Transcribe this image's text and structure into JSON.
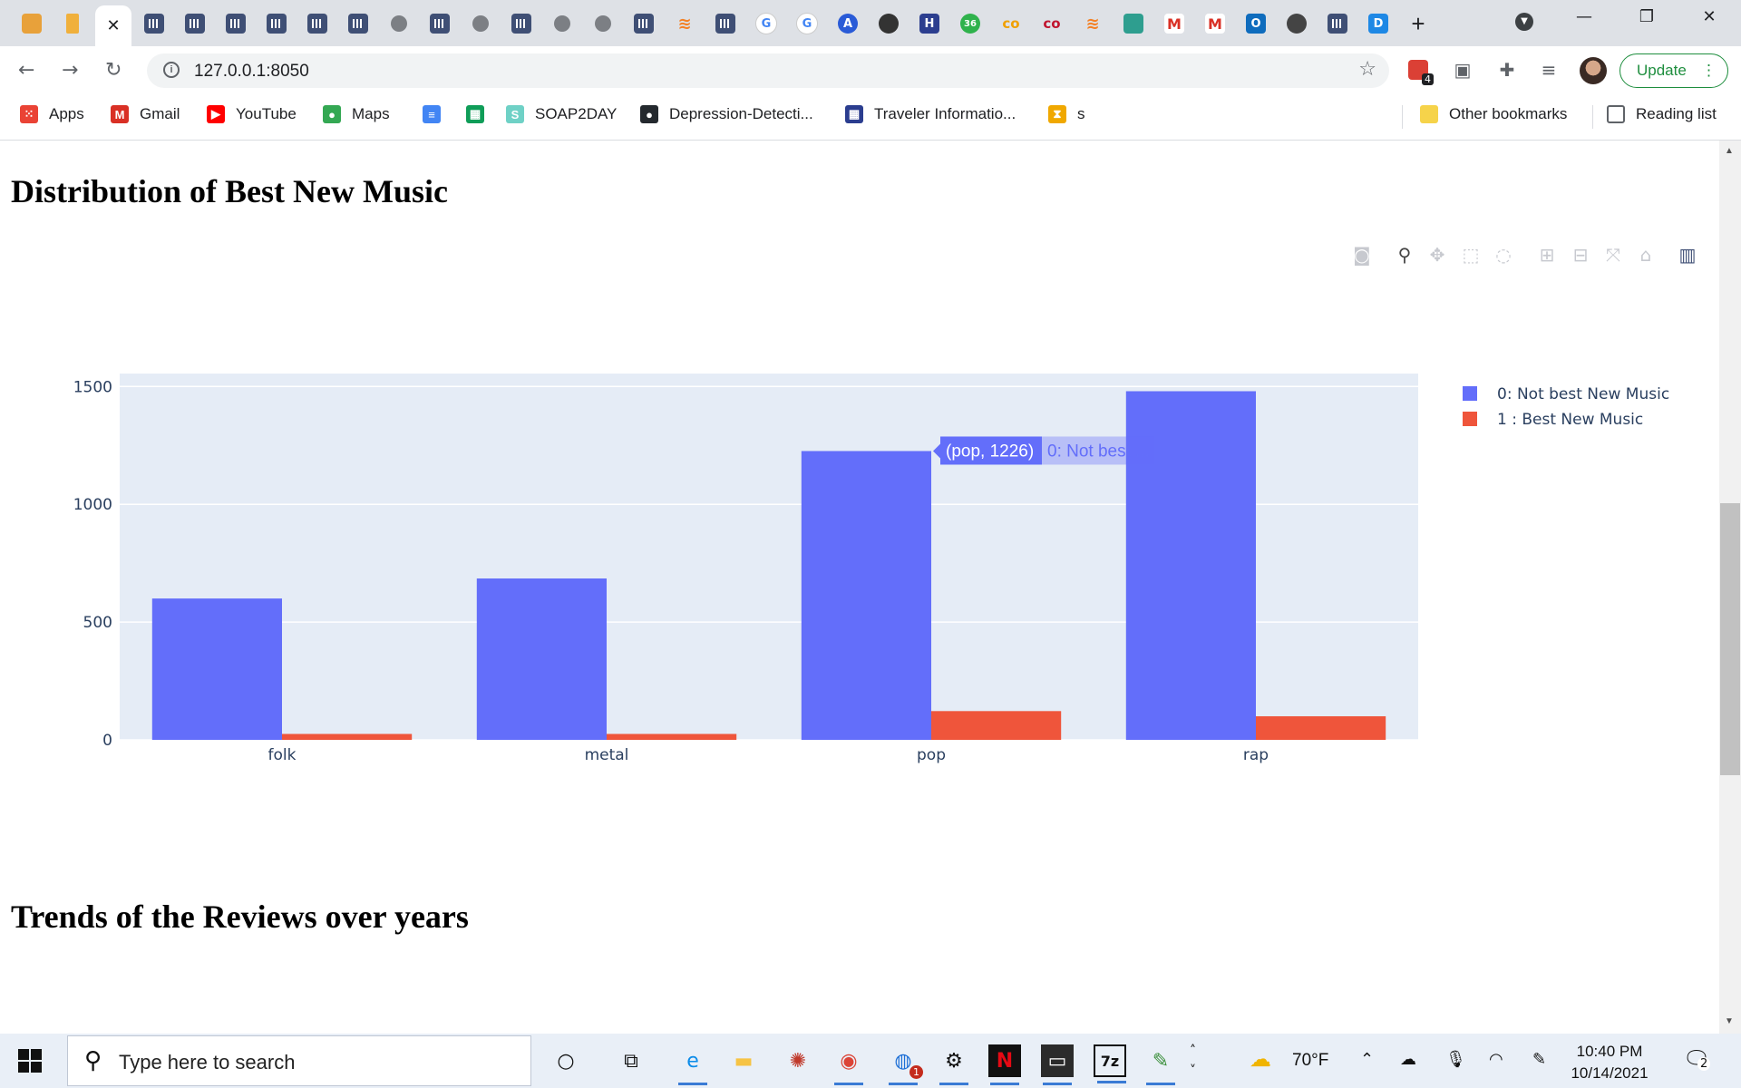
{
  "browser": {
    "tabs": [
      {
        "icon": "book-icon",
        "kind": "book"
      },
      {
        "icon": "hourglass-icon",
        "kind": "glass"
      },
      {
        "icon": "close-icon",
        "kind": "active"
      },
      {
        "icon": "plotly-icon",
        "kind": "plot"
      },
      {
        "icon": "plotly-icon",
        "kind": "plot"
      },
      {
        "icon": "plotly-icon",
        "kind": "plot"
      },
      {
        "icon": "plotly-icon",
        "kind": "plot"
      },
      {
        "icon": "plotly-icon",
        "kind": "plot"
      },
      {
        "icon": "plotly-icon",
        "kind": "plot"
      },
      {
        "icon": "globe-icon",
        "kind": "globe"
      },
      {
        "icon": "plotly-icon",
        "kind": "plot"
      },
      {
        "icon": "globe-icon",
        "kind": "globe"
      },
      {
        "icon": "plotly-icon",
        "kind": "plot"
      },
      {
        "icon": "globe-icon",
        "kind": "globe"
      },
      {
        "icon": "globe-icon",
        "kind": "globe"
      },
      {
        "icon": "plotly-icon",
        "kind": "plot"
      },
      {
        "icon": "stackoverflow-icon",
        "kind": "so"
      },
      {
        "icon": "plotly-icon",
        "kind": "plot"
      },
      {
        "icon": "google-icon",
        "kind": "g"
      },
      {
        "icon": "google-icon",
        "kind": "g"
      },
      {
        "icon": "a-icon",
        "kind": "a"
      },
      {
        "icon": "reader-icon",
        "kind": "sec"
      },
      {
        "icon": "h-icon",
        "kind": "h"
      },
      {
        "icon": "badge-36-icon",
        "kind": "n36"
      },
      {
        "icon": "co-icon",
        "kind": "co"
      },
      {
        "icon": "co-red-icon",
        "kind": "cor"
      },
      {
        "icon": "stackoverflow-icon",
        "kind": "so"
      },
      {
        "icon": "sheet-icon",
        "kind": "teal"
      },
      {
        "icon": "gmail-icon",
        "kind": "m"
      },
      {
        "icon": "gmail-icon",
        "kind": "m"
      },
      {
        "icon": "outlook-icon",
        "kind": "ol"
      },
      {
        "icon": "github-icon",
        "kind": "chr"
      },
      {
        "icon": "plotly-icon",
        "kind": "plot"
      },
      {
        "icon": "d-icon",
        "kind": "d"
      }
    ],
    "fav_glyphs": {
      "g": "G",
      "a": "A",
      "so": "≋",
      "h": "H",
      "n36": "36",
      "co": "co",
      "cor": "co",
      "m": "M",
      "ol": "O",
      "d": "D"
    },
    "new_tab_glyph": "+",
    "close_glyph": "✕",
    "url": "127.0.0.1:8050",
    "update_label": "Update",
    "ext_badge": "4",
    "bookmarks": [
      {
        "label": "Apps",
        "icon": "apps-grid-icon",
        "color": "#ea4335"
      },
      {
        "label": "Gmail",
        "icon": "gmail-icon",
        "color": "#d93025"
      },
      {
        "label": "YouTube",
        "icon": "youtube-icon",
        "color": "#ff0000"
      },
      {
        "label": "Maps",
        "icon": "maps-pin-icon",
        "color": "#34a853"
      },
      {
        "label": "",
        "icon": "docs-icon",
        "color": "#4285f4"
      },
      {
        "label": "",
        "icon": "sheets-icon",
        "color": "#0f9d58"
      },
      {
        "label": "SOAP2DAY",
        "icon": "soap2day-icon",
        "color": "#6fd1c6"
      },
      {
        "label": "Depression-Detecti...",
        "icon": "github-icon",
        "color": "#24292e"
      },
      {
        "label": "Traveler Informatio...",
        "icon": "traveler-icon",
        "color": "#2b3d8f"
      },
      {
        "label": "s",
        "icon": "hourglass-icon",
        "color": "#f0a800"
      }
    ],
    "other_bookmarks": "Other bookmarks",
    "reading_list": "Reading list"
  },
  "page": {
    "section1_title": "Distribution of Best New Music",
    "section2_title": "Trends of the Reviews over years"
  },
  "modebar": [
    "camera-icon",
    "zoom-icon",
    "pan-icon",
    "box-select-icon",
    "lasso-icon",
    "zoom-in-icon",
    "zoom-out-icon",
    "autoscale-icon",
    "reset-axes-icon",
    "plotly-logo-icon"
  ],
  "chart_data": {
    "type": "bar",
    "categories": [
      "folk",
      "metal",
      "pop",
      "rap"
    ],
    "series": [
      {
        "name": "0: Not best New Music",
        "values": [
          600,
          685,
          1226,
          1480
        ],
        "color": "#636efa"
      },
      {
        "name": "1 : Best New Music",
        "values": [
          25,
          25,
          122,
          100
        ],
        "color": "#ef553b"
      }
    ],
    "yticks": [
      0,
      500,
      1000,
      1500
    ],
    "ylim": [
      0,
      1555
    ],
    "grid": true,
    "legend_position": "top-right",
    "hover": {
      "point": "(pop, 1226)",
      "series": "0: Not best ..."
    }
  },
  "taskbar": {
    "search_placeholder": "Type here to search",
    "apps": [
      "cortana-icon",
      "task-view-icon",
      "edge-icon",
      "file-explorer-icon",
      "security-icon",
      "chrome-icon",
      "webex-icon",
      "settings-icon",
      "netflix-icon",
      "terminal-icon",
      "7zip-icon",
      "notepad-icon"
    ],
    "webex_badge": "1",
    "weather": "70°F",
    "time": "10:40 PM",
    "date": "10/14/2021",
    "notif_count": "2"
  }
}
